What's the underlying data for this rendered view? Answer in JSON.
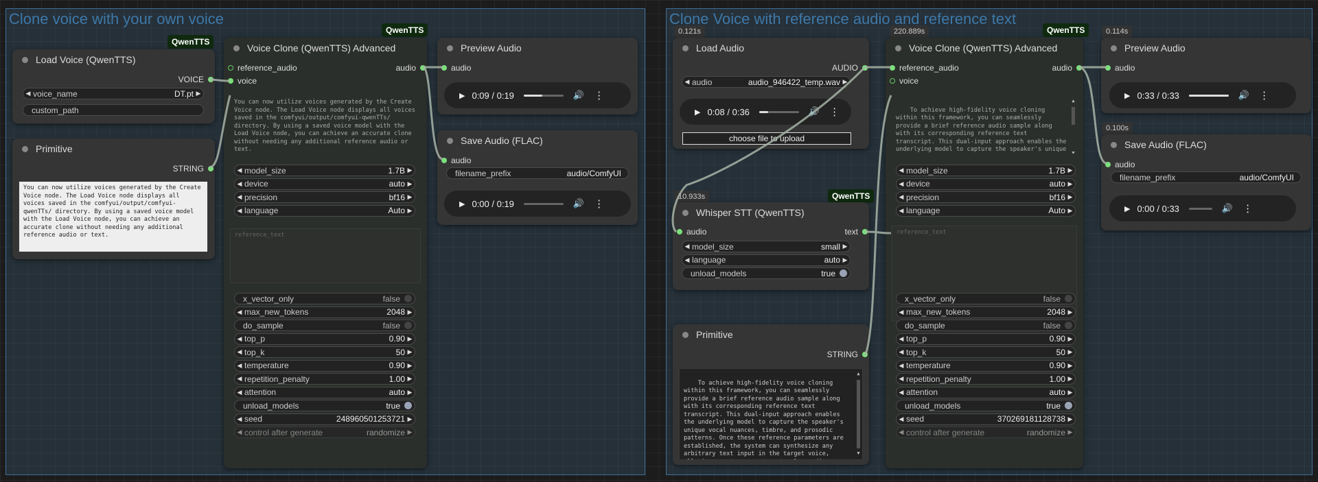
{
  "left": {
    "group_title": "Clone voice with your own voice",
    "load_voice": {
      "badge": "QwenTTS",
      "title": "Load Voice (QwenTTS)",
      "output": "VOICE",
      "voice_name_label": "voice_name",
      "voice_name_value": "DT.pt",
      "custom_path_label": "custom_path"
    },
    "primitive": {
      "title": "Primitive",
      "output": "STRING",
      "text": "You can now utilize voices generated by the Create Voice node. The Load Voice node displays all voices saved in the comfyui/output/comfyui-qwenTTs/ directory. By using a saved voice model with the Load Voice node, you can achieve an accurate clone without needing any additional reference audio or text."
    },
    "clone": {
      "badge": "QwenTTS",
      "title": "Voice Clone (QwenTTS) Advanced",
      "in_reference_audio": "reference_audio",
      "in_voice": "voice",
      "out_audio": "audio",
      "text": "You can now utilize voices generated by the Create Voice node. The Load Voice node displays all voices saved in the comfyui/output/comfyui-qwenTTs/ directory. By using a saved voice model with the Load Voice node, you can achieve an accurate clone without needing any additional reference audio or text.",
      "ref_placeholder": "reference_text",
      "widgets": [
        {
          "label": "model_size",
          "value": "1.7B"
        },
        {
          "label": "device",
          "value": "auto"
        },
        {
          "label": "precision",
          "value": "bf16"
        },
        {
          "label": "language",
          "value": "Auto"
        }
      ],
      "widgets2": [
        {
          "label": "x_vector_only",
          "value": "false"
        },
        {
          "label": "max_new_tokens",
          "value": "2048"
        },
        {
          "label": "do_sample",
          "value": "false"
        },
        {
          "label": "top_p",
          "value": "0.90"
        },
        {
          "label": "top_k",
          "value": "50"
        },
        {
          "label": "temperature",
          "value": "0.90"
        },
        {
          "label": "repetition_penalty",
          "value": "1.00"
        },
        {
          "label": "attention",
          "value": "auto"
        },
        {
          "label": "unload_models",
          "value": "true"
        },
        {
          "label": "seed",
          "value": "248960501253721"
        },
        {
          "label": "control after generate",
          "value": "randomize"
        }
      ]
    },
    "preview": {
      "title": "Preview Audio",
      "in_audio": "audio",
      "time": "0:09 / 0:19",
      "progress": 0.47
    },
    "save": {
      "title": "Save Audio (FLAC)",
      "in_audio": "audio",
      "prefix_label": "filename_prefix",
      "prefix_value": "audio/ComfyUI",
      "time": "0:00 / 0:19",
      "progress": 0
    }
  },
  "right": {
    "group_title": "Clone Voice with reference audio and reference text",
    "load_audio": {
      "timing": "0.121s",
      "title": "Load Audio",
      "output": "AUDIO",
      "audio_label": "audio",
      "audio_value": "audio_946422_temp.wav",
      "time": "0:08 / 0:36",
      "progress": 0.22,
      "upload": "choose file to upload"
    },
    "whisper": {
      "timing": "10.933s",
      "badge": "QwenTTS",
      "title": "Whisper STT (QwenTTS)",
      "in_audio": "audio",
      "out_text": "text",
      "widgets": [
        {
          "label": "model_size",
          "value": "small"
        },
        {
          "label": "language",
          "value": "auto"
        },
        {
          "label": "unload_models",
          "value": "true"
        }
      ]
    },
    "primitive": {
      "title": "Primitive",
      "output": "STRING",
      "text": "To achieve high-fidelity voice cloning within this framework, you can seamlessly provide a brief reference audio sample along with its corresponding reference text transcript. This dual-input approach enables the underlying model to capture the speaker's unique vocal nuances, timbre, and prosodic patterns. Once these reference parameters are established, the system can synthesize any arbitrary text input in the target voice, allowing you to generate natural-sounding speech that maintains the specific identity and characteristics of the"
    },
    "clone": {
      "timing": "220.889s",
      "badge": "QwenTTS",
      "title": "Voice Clone (QwenTTS) Advanced",
      "in_reference_audio": "reference_audio",
      "in_voice": "voice",
      "out_audio": "audio",
      "text": "To achieve high-fidelity voice cloning within this framework, you can seamlessly provide a brief reference audio sample along with its corresponding reference text transcript. This dual-input approach enables the underlying model to capture the speaker's unique vocal nuances, timbre, and prosodic patterns. Once",
      "ref_placeholder": "reference_text",
      "widgets": [
        {
          "label": "model_size",
          "value": "1.7B"
        },
        {
          "label": "device",
          "value": "auto"
        },
        {
          "label": "precision",
          "value": "bf16"
        },
        {
          "label": "language",
          "value": "Auto"
        }
      ],
      "widgets2": [
        {
          "label": "x_vector_only",
          "value": "false"
        },
        {
          "label": "max_new_tokens",
          "value": "2048"
        },
        {
          "label": "do_sample",
          "value": "false"
        },
        {
          "label": "top_p",
          "value": "0.90"
        },
        {
          "label": "top_k",
          "value": "50"
        },
        {
          "label": "temperature",
          "value": "0.90"
        },
        {
          "label": "repetition_penalty",
          "value": "1.00"
        },
        {
          "label": "attention",
          "value": "auto"
        },
        {
          "label": "unload_models",
          "value": "true"
        },
        {
          "label": "seed",
          "value": "370269181128738"
        },
        {
          "label": "control after generate",
          "value": "randomize"
        }
      ]
    },
    "preview": {
      "timing": "0.114s",
      "title": "Preview Audio",
      "in_audio": "audio",
      "time": "0:33 / 0:33",
      "progress": 1
    },
    "save": {
      "timing": "0.100s",
      "title": "Save Audio (FLAC)",
      "in_audio": "audio",
      "prefix_label": "filename_prefix",
      "prefix_value": "audio/ComfyUI",
      "time": "0:00 / 0:33",
      "progress": 0
    }
  }
}
